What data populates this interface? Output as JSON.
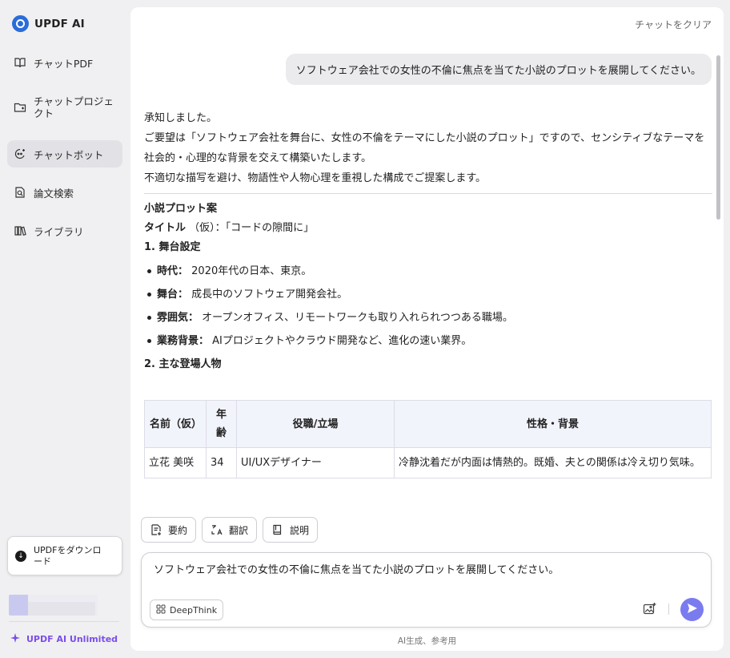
{
  "sidebar": {
    "brand": "UPDF AI",
    "items": [
      {
        "label": "チャットPDF",
        "icon": "book-icon"
      },
      {
        "label": "チャットプロジェクト",
        "icon": "folder-icon"
      },
      {
        "label": "チャットボット",
        "icon": "bot-icon",
        "active": true
      },
      {
        "label": "論文検索",
        "icon": "paper-search-icon"
      },
      {
        "label": "ライブラリ",
        "icon": "library-icon"
      }
    ],
    "download_label": "UPDFをダウンロード",
    "unlimited_label": "UPDF AI Unlimited"
  },
  "header": {
    "clear_label": "チャットをクリア"
  },
  "chat": {
    "user_message": "ソフトウェア会社での女性の不倫に焦点を当てた小説のプロットを展開してください。",
    "intro": [
      "承知しました。",
      "ご要望は「ソフトウェア会社を舞台に、女性の不倫をテーマにした小説のプロット」ですので、センシティブなテーマを社会的・心理的な背景を交えて構築いたします。",
      "不適切な描写を避け、物語性や人物心理を重視した構成でご提案します。"
    ],
    "plot_heading": "小説プロット案",
    "title_label": "タイトル",
    "title_value": "（仮）：「コードの隙間に」",
    "section1_heading": "1. 舞台設定",
    "settings": [
      {
        "label": "時代：",
        "value": "2020年代の日本、東京。"
      },
      {
        "label": "舞台：",
        "value": "成長中のソフトウェア開発会社。"
      },
      {
        "label": "雰囲気：",
        "value": "オープンオフィス、リモートワークも取り入れられつつある職場。"
      },
      {
        "label": "業務背景：",
        "value": "AIプロジェクトやクラウド開発など、進化の速い業界。"
      }
    ],
    "section2_heading": "2. 主な登場人物",
    "table": {
      "headers": [
        "名前（仮）",
        "年齢",
        "役職/立場",
        "性格・背景"
      ],
      "rows": [
        [
          "立花 美咲",
          "34",
          "UI/UXデザイナー",
          "冷静沈着だが内面は情熱的。既婚、夫との関係は冷え切り気味。"
        ]
      ]
    }
  },
  "actions": {
    "summarize": "要約",
    "translate": "翻訳",
    "explain": "説明"
  },
  "composer": {
    "value": "ソフトウェア会社での女性の不倫に焦点を当てた小説のプロットを展開してください。",
    "deepthink_label": "DeepThink"
  },
  "footer": {
    "note": "AI生成、参考用"
  },
  "colors": {
    "accent": "#7b7bf0",
    "brand": "#2a6dd9",
    "unlimited": "#7b4ee8"
  }
}
